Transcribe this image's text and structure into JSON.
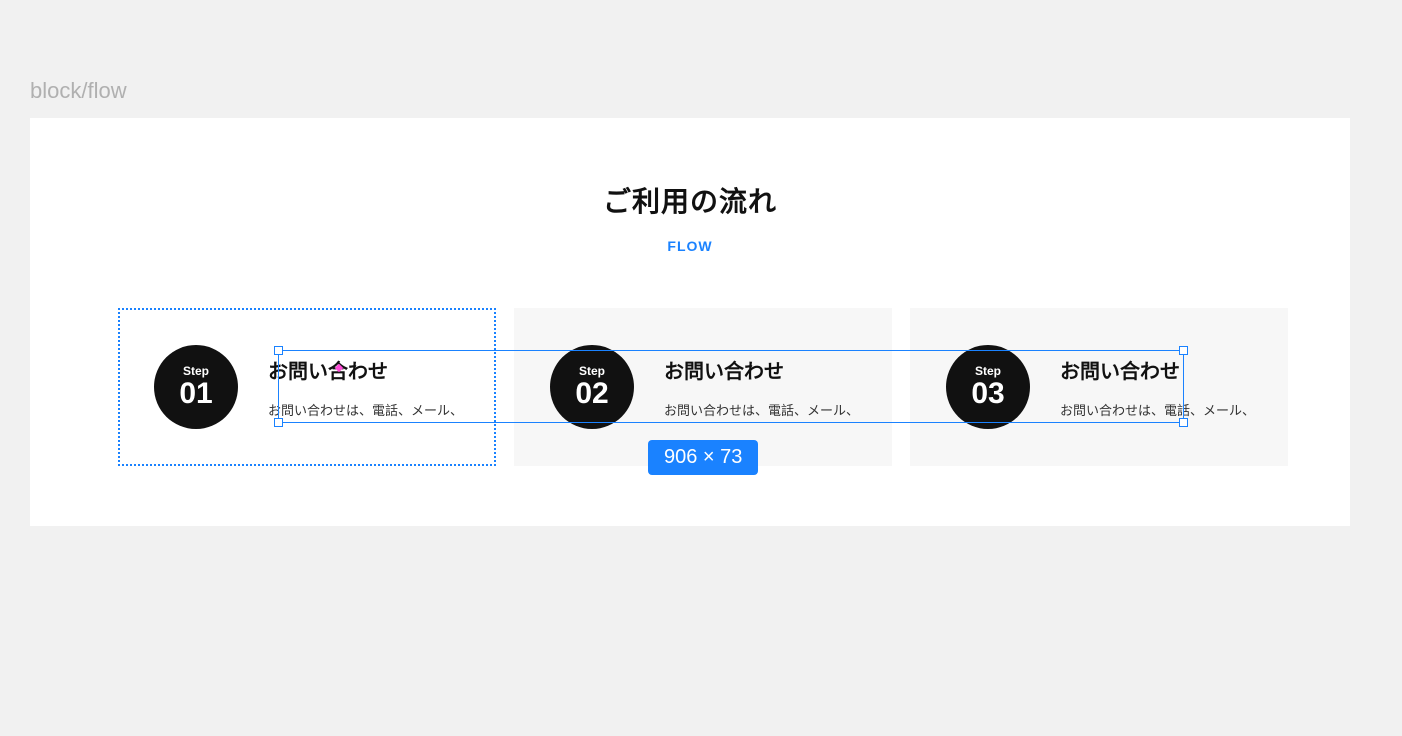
{
  "breadcrumb": "block/flow",
  "header": {
    "title": "ご利用の流れ",
    "subtitle": "FLOW"
  },
  "steps": [
    {
      "stepLabel": "Step",
      "stepNumber": "01",
      "title": "お問い合わせ",
      "desc": "お問い合わせは、電話、メール、"
    },
    {
      "stepLabel": "Step",
      "stepNumber": "02",
      "title": "お問い合わせ",
      "desc": "お問い合わせは、電話、メール、"
    },
    {
      "stepLabel": "Step",
      "stepNumber": "03",
      "title": "お問い合わせ",
      "desc": "お問い合わせは、電話、メール、"
    }
  ],
  "selection": {
    "sizeLabel": "906 × 73"
  }
}
